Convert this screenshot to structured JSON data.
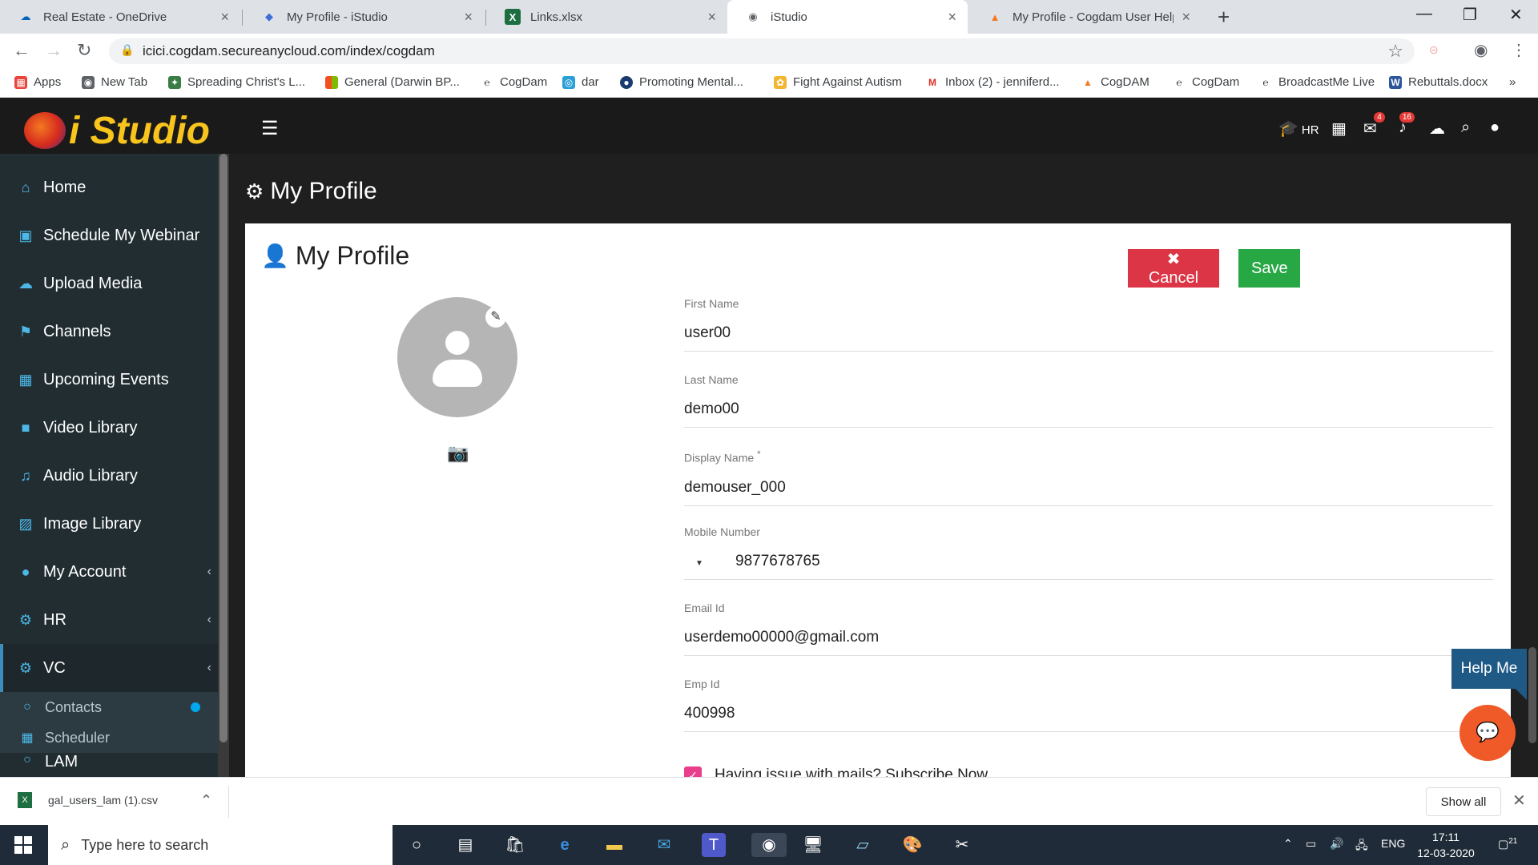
{
  "browser": {
    "tabs": [
      {
        "title": "Real Estate - OneDrive",
        "active": false
      },
      {
        "title": "My Profile - iStudio",
        "active": false
      },
      {
        "title": "Links.xlsx",
        "active": false
      },
      {
        "title": "iStudio",
        "active": true
      },
      {
        "title": "My Profile - Cogdam User Help M",
        "active": false
      }
    ],
    "url": "icici.cogdam.secureanycloud.com/index/cogdam",
    "bookmarks": [
      "Apps",
      "New Tab",
      "Spreading Christ's L...",
      "General (Darwin BP...",
      "CogDam",
      "dar",
      "Promoting Mental...",
      "Fight Against Autism",
      "Inbox (2) - jenniferd...",
      "CogDAM",
      "CogDam",
      "BroadcastMe Live",
      "Rebuttals.docx"
    ]
  },
  "app": {
    "logo_text": "i Studio",
    "top_icons": {
      "hr_label": "HR",
      "messages_badge": "4",
      "notifications_badge": "16"
    }
  },
  "sidebar": {
    "items": [
      {
        "label": "Home",
        "icon": "home-icon"
      },
      {
        "label": "Schedule My Webinar",
        "icon": "calendar-plus-icon"
      },
      {
        "label": "Upload Media",
        "icon": "cloud-upload-icon"
      },
      {
        "label": "Channels",
        "icon": "bookmark-icon"
      },
      {
        "label": "Upcoming Events",
        "icon": "calendar-icon"
      },
      {
        "label": "Video Library",
        "icon": "video-camera-icon"
      },
      {
        "label": "Audio Library",
        "icon": "music-note-icon"
      },
      {
        "label": "Image Library",
        "icon": "image-icon"
      },
      {
        "label": "My Account",
        "icon": "user-icon"
      },
      {
        "label": "HR",
        "icon": "gears-icon"
      },
      {
        "label": "VC",
        "icon": "gears-icon"
      }
    ],
    "sub_items": [
      {
        "label": "Contacts"
      },
      {
        "label": "Scheduler"
      }
    ],
    "partial_item": "LAM"
  },
  "page": {
    "title": "My Profile",
    "card_title": "My Profile",
    "cancel_label": "Cancel",
    "save_label": "Save",
    "fields": {
      "first_name": {
        "label": "First Name",
        "value": "user00"
      },
      "last_name": {
        "label": "Last Name",
        "value": "demo00"
      },
      "display_name": {
        "label": "Display Name",
        "required_mark": "*",
        "value": "demouser_000"
      },
      "mobile": {
        "label": "Mobile Number",
        "value": "9877678765"
      },
      "email": {
        "label": "Email Id",
        "value": "userdemo00000@gmail.com"
      },
      "emp_id": {
        "label": "Emp Id",
        "value": "400998"
      }
    },
    "subscribe_text": "Having issue with mails? Subscribe Now"
  },
  "help": {
    "label": "Help Me"
  },
  "download_bar": {
    "file_name": "gal_users_lam (1).csv",
    "show_all_label": "Show all"
  },
  "taskbar": {
    "search_placeholder": "Type here to search",
    "language": "ENG",
    "time": "17:11",
    "date": "12-03-2020",
    "notification_count": "21"
  }
}
